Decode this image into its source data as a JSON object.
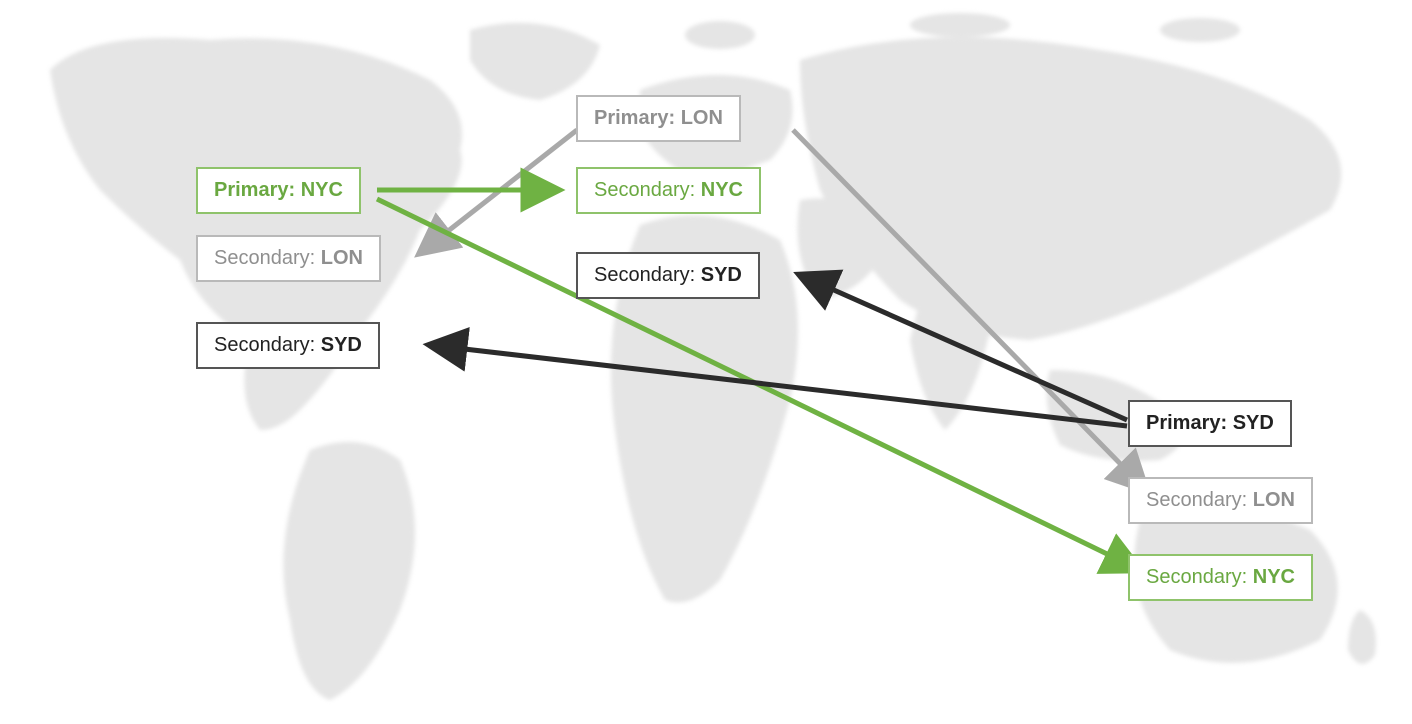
{
  "colors": {
    "nyc": "#6aa841",
    "lon": "#8f8f8f",
    "syd": "#222222",
    "map": "#e5e5e5"
  },
  "nodes": {
    "left": [
      {
        "role": "Primary",
        "city": "NYC",
        "theme": "green"
      },
      {
        "role": "Secondary",
        "city": "LON",
        "theme": "gray"
      },
      {
        "role": "Secondary",
        "city": "SYD",
        "theme": "black"
      }
    ],
    "center": [
      {
        "role": "Primary",
        "city": "LON",
        "theme": "gray"
      },
      {
        "role": "Secondary",
        "city": "NYC",
        "theme": "green"
      },
      {
        "role": "Secondary",
        "city": "SYD",
        "theme": "black"
      }
    ],
    "right": [
      {
        "role": "Primary",
        "city": "SYD",
        "theme": "black"
      },
      {
        "role": "Secondary",
        "city": "LON",
        "theme": "gray"
      },
      {
        "role": "Secondary",
        "city": "NYC",
        "theme": "green"
      }
    ]
  },
  "arrows": [
    {
      "from": "Primary: LON",
      "to": "Secondary: LON (left)",
      "color": "gray"
    },
    {
      "from": "Primary: LON",
      "to": "Secondary: LON (right)",
      "color": "gray"
    },
    {
      "from": "Primary: NYC",
      "to": "Secondary: NYC (center)",
      "color": "green"
    },
    {
      "from": "Primary: NYC",
      "to": "Secondary: NYC (right)",
      "color": "green"
    },
    {
      "from": "Primary: SYD",
      "to": "Secondary: SYD (center)",
      "color": "black"
    },
    {
      "from": "Primary: SYD",
      "to": "Secondary: SYD (left)",
      "color": "black"
    }
  ]
}
